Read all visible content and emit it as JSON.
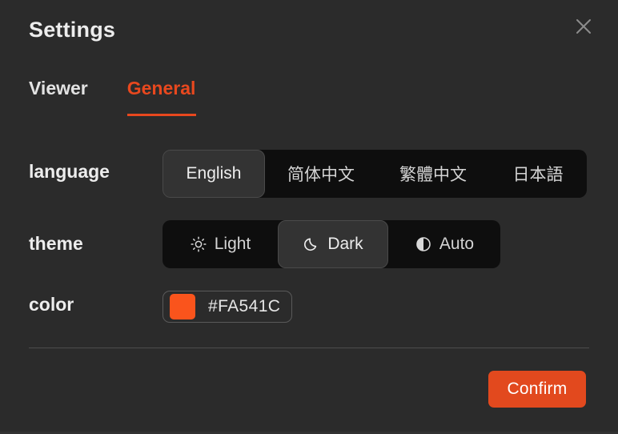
{
  "dialog": {
    "title": "Settings",
    "close_icon": "close-icon",
    "background_color": "#2b2b2b"
  },
  "tabs": [
    {
      "id": "viewer",
      "label": "Viewer",
      "active": false
    },
    {
      "id": "general",
      "label": "General",
      "active": true
    }
  ],
  "accent_color": "#e8481e",
  "rows": {
    "language": {
      "label": "language",
      "options": [
        {
          "id": "english",
          "label": "English",
          "selected": true
        },
        {
          "id": "zh-hans",
          "label": "简体中文",
          "selected": false
        },
        {
          "id": "zh-hant",
          "label": "繁體中文",
          "selected": false
        },
        {
          "id": "ja",
          "label": "日本語",
          "selected": false
        }
      ],
      "selected_value": "English"
    },
    "theme": {
      "label": "theme",
      "options": [
        {
          "id": "light",
          "label": "Light",
          "icon": "sun-icon",
          "selected": false
        },
        {
          "id": "dark",
          "label": "Dark",
          "icon": "moon-icon",
          "selected": true
        },
        {
          "id": "auto",
          "label": "Auto",
          "icon": "half-circle-icon",
          "selected": false
        }
      ],
      "selected_value": "Dark"
    },
    "color": {
      "label": "color",
      "value": "#FA541C",
      "swatch_color": "#FA541C"
    }
  },
  "footer": {
    "confirm_label": "Confirm",
    "confirm_color": "#e2491e"
  }
}
